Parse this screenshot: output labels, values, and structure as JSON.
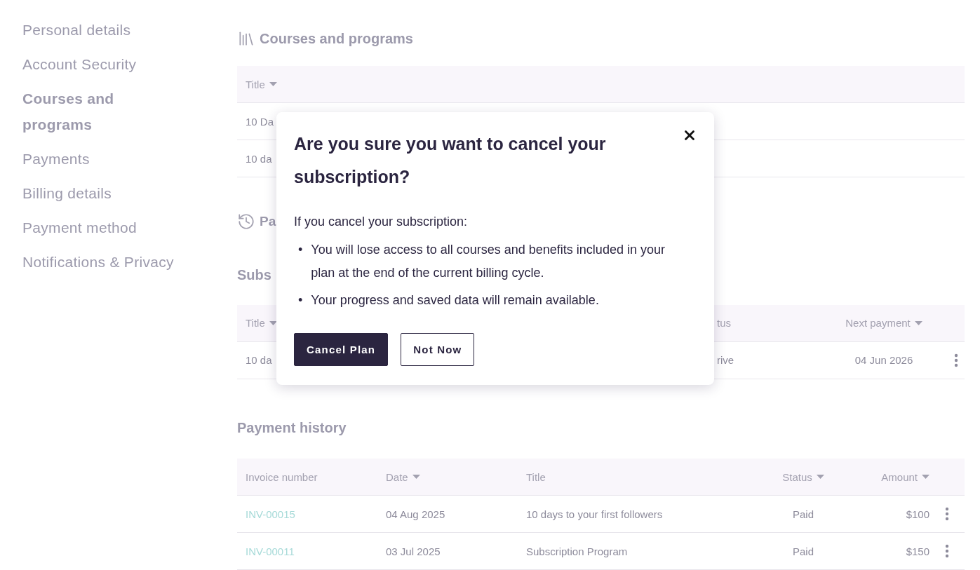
{
  "sidebar": {
    "items": [
      {
        "label": "Personal details",
        "selected": false
      },
      {
        "label": "Account Security",
        "selected": false
      },
      {
        "label": "Courses and programs",
        "selected": true
      },
      {
        "label": "Payments",
        "selected": false
      },
      {
        "label": "Billing details",
        "selected": false
      },
      {
        "label": "Payment method",
        "selected": false
      },
      {
        "label": "Notifications & Privacy",
        "selected": false
      }
    ]
  },
  "courses": {
    "title": "Courses and programs",
    "columns": [
      {
        "label": "Title",
        "sortable": true
      }
    ],
    "rows": [
      {
        "cells": [
          "10 Da"
        ]
      },
      {
        "cells": [
          "10 da"
        ]
      }
    ]
  },
  "payments_section": {
    "title": "Pa"
  },
  "subscriptions": {
    "title": "Subs",
    "columns": [
      {
        "label": "Title",
        "sortable": true
      },
      {
        "label": "tus",
        "sortable": false
      },
      {
        "label": "Next payment",
        "sortable": true
      }
    ],
    "rows": [
      {
        "cells": [
          "10 da",
          "rive",
          "04 Jun 2026"
        ]
      }
    ]
  },
  "payment_history": {
    "title": "Payment history",
    "columns": [
      {
        "label": "Invoice number",
        "sortable": false
      },
      {
        "label": "Date",
        "sortable": true
      },
      {
        "label": "Title",
        "sortable": false
      },
      {
        "label": "Status",
        "sortable": true
      },
      {
        "label": "Amount",
        "sortable": true
      }
    ],
    "rows": [
      {
        "invoice": "INV-00015",
        "date": "04 Aug 2025",
        "title": "10 days to your first followers",
        "status": "Paid",
        "amount": "$100"
      },
      {
        "invoice": "INV-00011",
        "date": "03 Jul 2025",
        "title": "Subscription Program",
        "status": "Paid",
        "amount": "$150"
      }
    ]
  },
  "modal": {
    "title": "Are you sure you want to cancel your subscription?",
    "intro": "If you cancel your subscription:",
    "bullet_marker": "•",
    "bullets": [
      "You will lose access to all courses and benefits included in your plan at the end of the current billing cycle.",
      "Your progress and saved data will remain available."
    ],
    "buttons": [
      {
        "label": "Cancel Plan",
        "kind": "primary"
      },
      {
        "label": "Not Now",
        "kind": "secondary"
      }
    ]
  }
}
